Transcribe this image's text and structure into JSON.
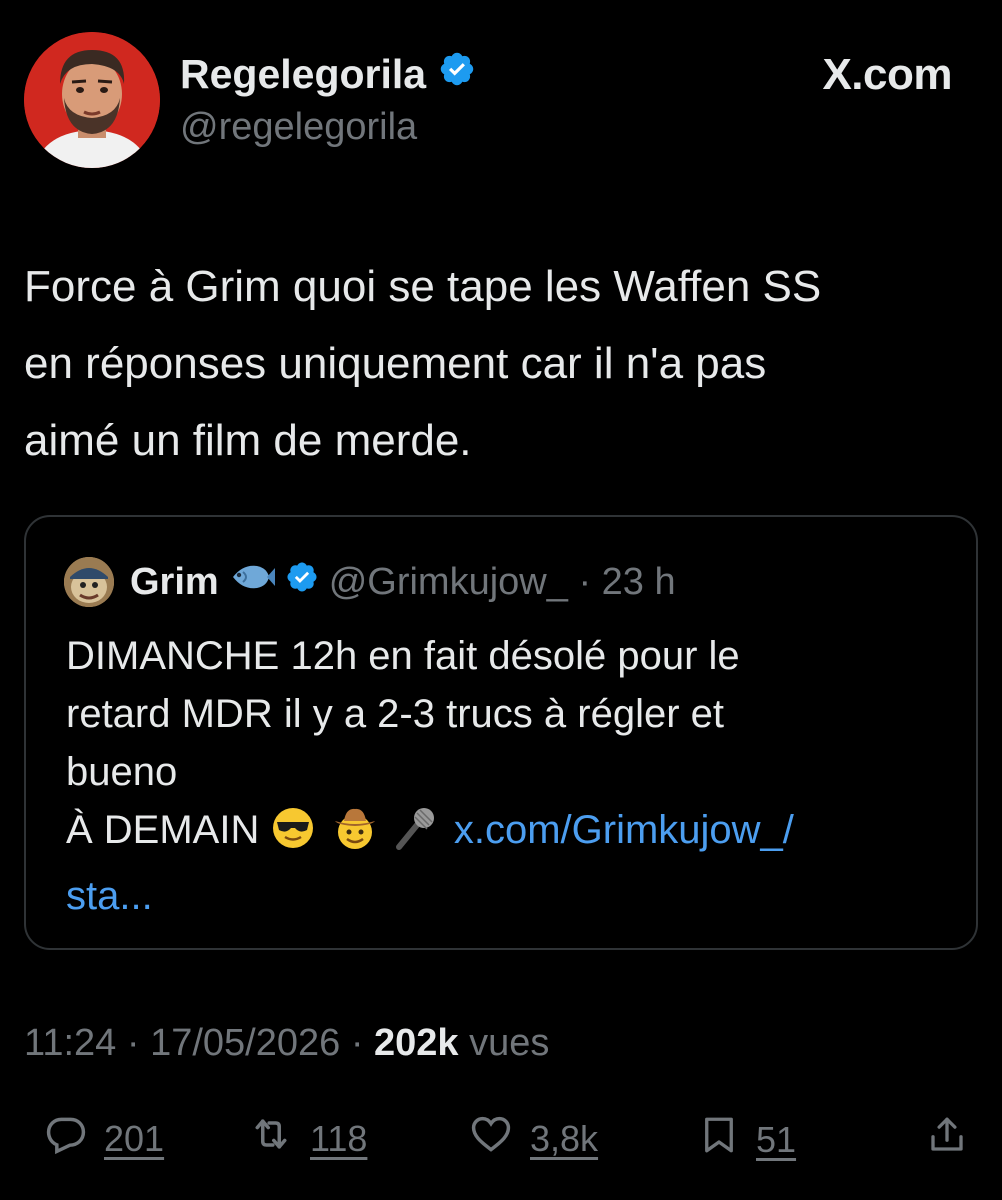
{
  "header": {
    "display_name": "Regelegorila",
    "handle": "@regelegorila",
    "brand": "X.com",
    "verified_color": "#1d9bf0"
  },
  "tweet": {
    "lines": [
      "Force à Grim quoi se tape les Waffen SS",
      "en réponses uniquement car il n'a pas",
      "aimé un film de merde."
    ]
  },
  "quote": {
    "name": "Grim",
    "handle": "@Grimkujow_",
    "dot": "·",
    "time": "23 h",
    "lines": [
      "DIMANCHE 12h en fait désolé pour le",
      "retard MDR il y a 2-3 trucs à régler et",
      "bueno"
    ],
    "last_line_text": "À DEMAIN",
    "emojis": [
      "sunglasses-face",
      "cowboy-face",
      "microphone"
    ],
    "link_part1": "x.com/Grimkujow_/",
    "link_part2": "sta...",
    "link_color": "#4c9ef0"
  },
  "meta": {
    "time": "11:24",
    "sep": "·",
    "date": "17/05/2026",
    "views_count": "202k",
    "views_label": "vues"
  },
  "actions": {
    "replies": "201",
    "reposts": "118",
    "likes": "3,8k",
    "bookmarks": "51"
  }
}
